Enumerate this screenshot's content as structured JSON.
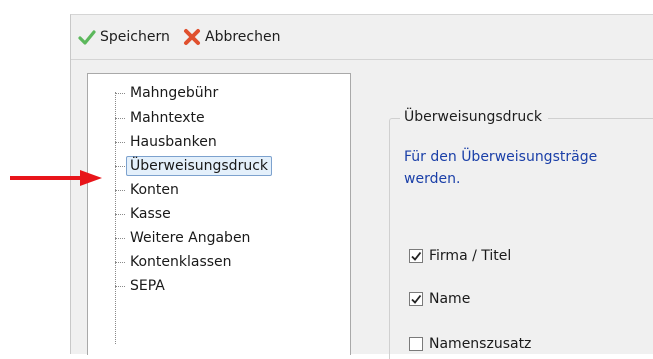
{
  "toolbar": {
    "save": {
      "label": "Speichern",
      "icon": "checkmark-icon",
      "icon_color": "#5cb85c"
    },
    "cancel": {
      "label": "Abbrechen",
      "icon": "cross-icon",
      "icon_color": "#e0502e"
    }
  },
  "tree": {
    "items": [
      {
        "label": "Mahngebühr",
        "selected": false
      },
      {
        "label": "Mahntexte",
        "selected": false
      },
      {
        "label": "Hausbanken",
        "selected": false
      },
      {
        "label": "Überweisungsdruck",
        "selected": true
      },
      {
        "label": "Konten",
        "selected": false
      },
      {
        "label": "Kasse",
        "selected": false
      },
      {
        "label": "Weitere Angaben",
        "selected": false
      },
      {
        "label": "Kontenklassen",
        "selected": false
      },
      {
        "label": "SEPA",
        "selected": false
      }
    ]
  },
  "group": {
    "title": "Überweisungsdruck",
    "info_lines": [
      "Für den Überweisungsträge",
      "werden."
    ],
    "options": [
      {
        "label": "Firma / Titel",
        "checked": true
      },
      {
        "label": "Name",
        "checked": true
      },
      {
        "label": "Namenszusatz",
        "checked": false
      }
    ]
  },
  "annotation": {
    "arrow_color": "#e8151a",
    "points_to": "Überweisungsdruck"
  }
}
